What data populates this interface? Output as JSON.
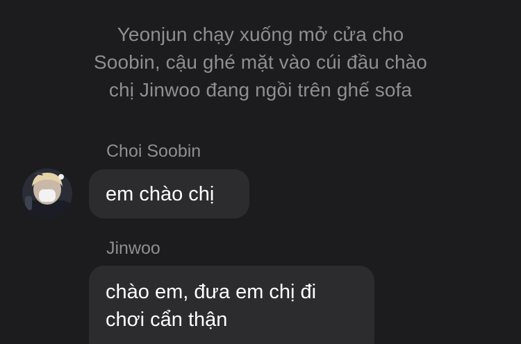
{
  "narration": {
    "line1": "Yeonjun chạy xuống mở cửa cho",
    "line2": "Soobin, cậu ghé mặt vào cúi đầu chào",
    "line3": "chị Jinwoo đang ngồi trên ghế sofa"
  },
  "messages": [
    {
      "sender": "Choi Soobin",
      "lines": [
        "em chào chị"
      ]
    },
    {
      "sender": "Jinwoo",
      "lines": [
        "chào em, đưa em chị đi",
        "chơi cẩn thận"
      ]
    }
  ],
  "colors": {
    "background": "#1c1c1e",
    "bubble": "#2c2c2e",
    "secondary_text": "#8e8e93",
    "primary_text": "#ffffff"
  }
}
